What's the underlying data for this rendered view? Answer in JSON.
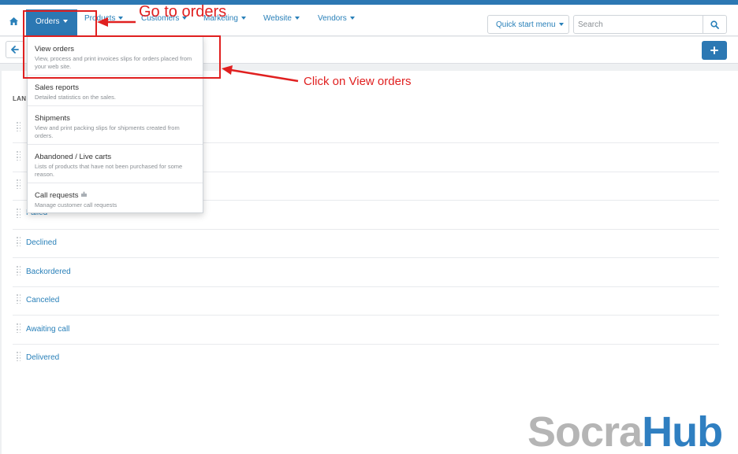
{
  "nav": {
    "items": [
      {
        "label": "Orders"
      },
      {
        "label": "Products"
      },
      {
        "label": "Customers"
      },
      {
        "label": "Marketing"
      },
      {
        "label": "Website"
      },
      {
        "label": "Vendors"
      }
    ],
    "quick_start": "Quick start menu",
    "search_placeholder": "Search"
  },
  "dropdown": {
    "items": [
      {
        "title": "View orders",
        "desc": "View, process and print invoices slips for orders placed from your web site."
      },
      {
        "title": "Sales reports",
        "desc": "Detailed statistics on the sales."
      },
      {
        "title": "Shipments",
        "desc": "View and print packing slips for shipments created from orders."
      },
      {
        "title": "Abandoned / Live carts",
        "desc": "Lists of products that have not been purchased for some reason."
      },
      {
        "title": "Call requests",
        "desc": "Manage customer call requests"
      }
    ]
  },
  "content": {
    "lang_label": "LAN",
    "statuses": [
      {
        "label": ""
      },
      {
        "label": ""
      },
      {
        "label": ""
      },
      {
        "label": "Failed"
      },
      {
        "label": "Declined"
      },
      {
        "label": "Backordered"
      },
      {
        "label": "Canceled"
      },
      {
        "label": "Awaiting call"
      },
      {
        "label": "Delivered"
      }
    ]
  },
  "annotations": {
    "go_to_orders": "Go to orders",
    "click_view_orders": "Click on View orders"
  },
  "watermark": {
    "part1": "Socra",
    "part2": "Hub"
  },
  "icons": {
    "home": "home-icon",
    "search": "search-icon",
    "back": "arrow-left-icon",
    "add": "plus-icon",
    "badge": "puzzle-icon",
    "drag": "drag-handle-icon"
  },
  "colors": {
    "accent": "#2c78b3",
    "link": "#2980b9",
    "annotation": "#e02020",
    "watermark_gray": "#b5b5b5",
    "watermark_blue": "#2f7fc1"
  }
}
